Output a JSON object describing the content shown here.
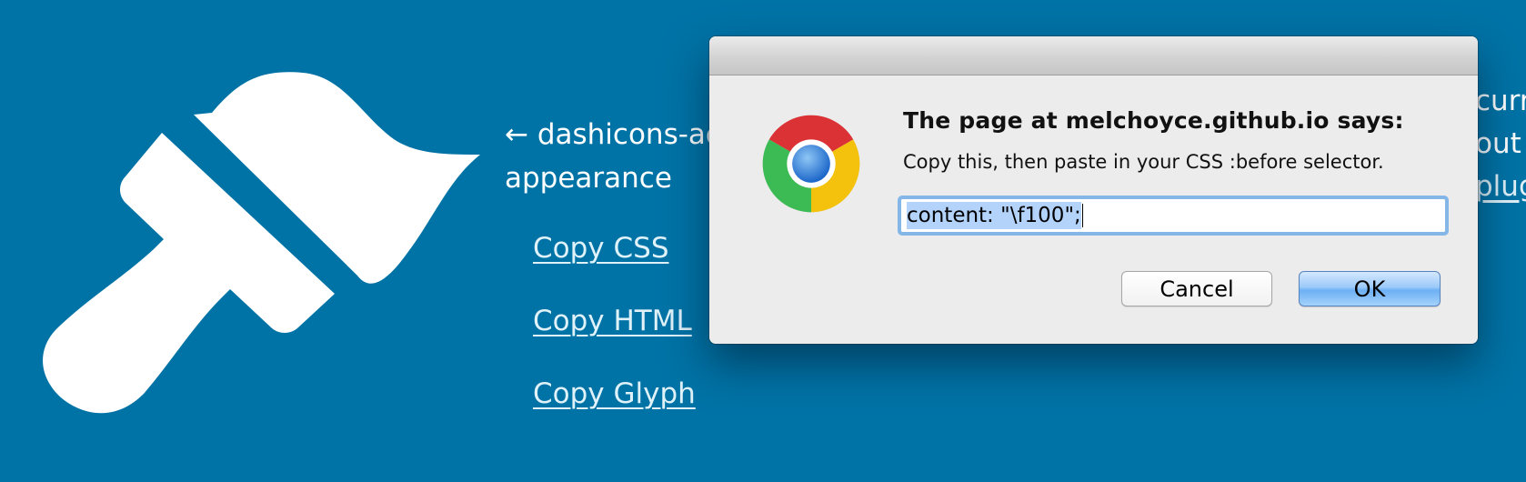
{
  "background": {
    "glyph_title_line1": "← dashicons-ad",
    "glyph_title_line2": "appearance",
    "links": {
      "copy_css": "Copy CSS",
      "copy_html": "Copy HTML",
      "copy_glyph": "Copy Glyph"
    },
    "right_fragments": [
      "curr",
      "out",
      "plug"
    ],
    "colors": {
      "page_bg": "#0073a6",
      "link": "#dff1f9"
    },
    "icon": "paintbrush-icon"
  },
  "dialog": {
    "heading": "The page at melchoyce.github.io says:",
    "message": "Copy this, then paste in your CSS :before selector.",
    "input_value": "content: \"\\f100\";",
    "cancel_label": "Cancel",
    "ok_label": "OK",
    "icon": "chrome-logo-icon"
  }
}
